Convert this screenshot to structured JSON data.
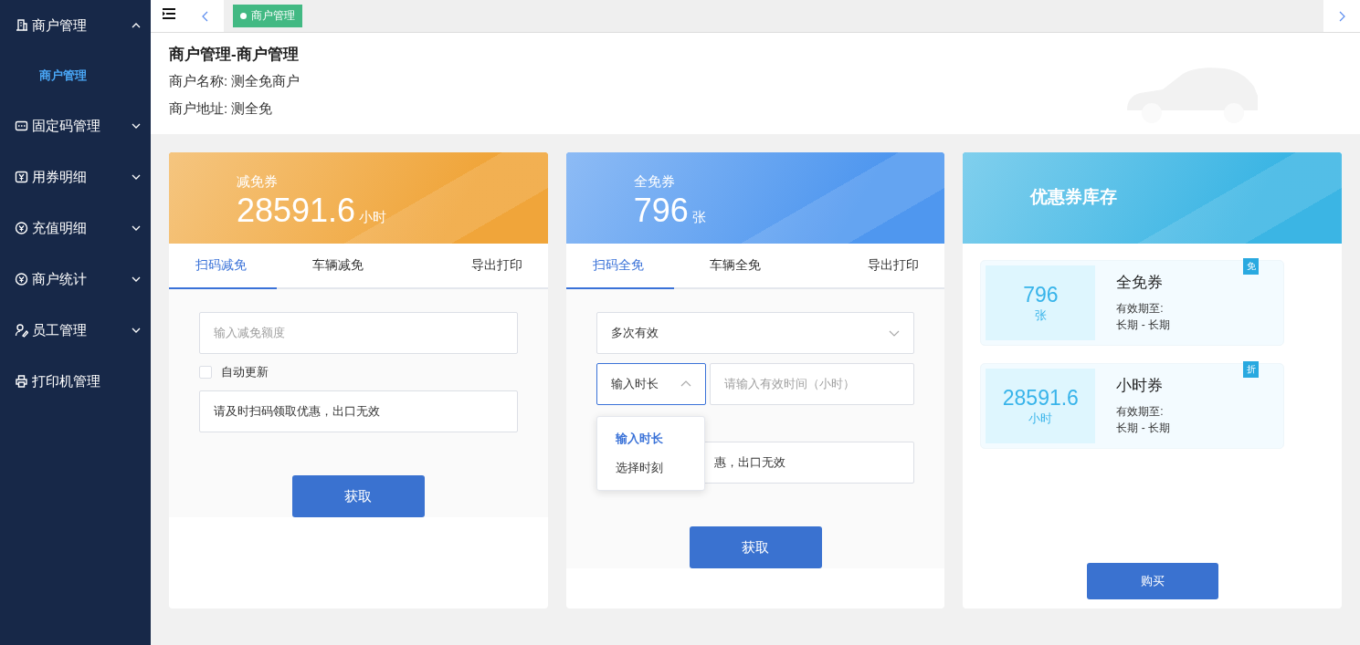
{
  "sidebar": {
    "items": [
      {
        "label": "商户管理",
        "expanded": true,
        "children": [
          {
            "label": "商户管理",
            "selected": true
          }
        ]
      },
      {
        "label": "固定码管理",
        "expanded": false
      },
      {
        "label": "用券明细",
        "expanded": false
      },
      {
        "label": "充值明细",
        "expanded": false
      },
      {
        "label": "商户统计",
        "expanded": false
      },
      {
        "label": "员工管理",
        "expanded": false
      },
      {
        "label": "打印机管理"
      }
    ]
  },
  "tabs_bar": {
    "tabs": [
      {
        "label": "商户管理",
        "selected": true
      }
    ]
  },
  "header": {
    "title": "商户管理-商户管理",
    "lines": [
      "商户名称: 测全免商户",
      "商户地址: 测全免"
    ]
  },
  "cards": [
    {
      "kind": "summary",
      "color": "#f0a53a",
      "title": "减免券",
      "amount": "28591.6",
      "unit": "小时",
      "tabs": [
        {
          "label": "扫码减免",
          "selected": true
        },
        {
          "label": "车辆减免",
          "selected": false
        },
        {
          "label": "导出打印",
          "selected": false
        }
      ],
      "fields": [
        {
          "kind": "input",
          "placeholder": "输入减免额度"
        },
        {
          "kind": "checkbox",
          "label": "自动更新",
          "checked": false
        },
        {
          "kind": "input",
          "value": "请及时扫码领取优惠，出口无效"
        }
      ],
      "button": "获取"
    },
    {
      "kind": "summary",
      "color": "#4f97ef",
      "title": "全免券",
      "amount": "796",
      "unit": "张",
      "tabs": [
        {
          "label": "扫码全免",
          "selected": true
        },
        {
          "label": "车辆全免",
          "selected": false
        },
        {
          "label": "导出打印",
          "selected": false
        }
      ],
      "fields": [
        {
          "kind": "select",
          "value": "多次有效",
          "open": false
        },
        {
          "kind": "select-input",
          "value": "输入时长",
          "open": true,
          "options": [
            {
              "label": "输入时长",
              "selected": true
            },
            {
              "label": "选择时刻",
              "selected": false
            }
          ],
          "placeholder": "请输入有效时间（小时）"
        },
        {
          "kind": "input",
          "value": "惠，出口无效"
        }
      ],
      "button": "获取"
    },
    {
      "kind": "inventory",
      "color": "#3bb5e4",
      "title": "优惠券库存",
      "coupons": [
        {
          "amount": "796",
          "unit": "张",
          "name": "全免券",
          "validity_label": "有效期至:",
          "validity": "长期 - 长期",
          "tag": "免"
        },
        {
          "amount": "28591.6",
          "unit": "小时",
          "name": "小时券",
          "validity_label": "有效期至:",
          "validity": "长期 - 长期",
          "tag": "折"
        }
      ],
      "button": "购买"
    }
  ]
}
